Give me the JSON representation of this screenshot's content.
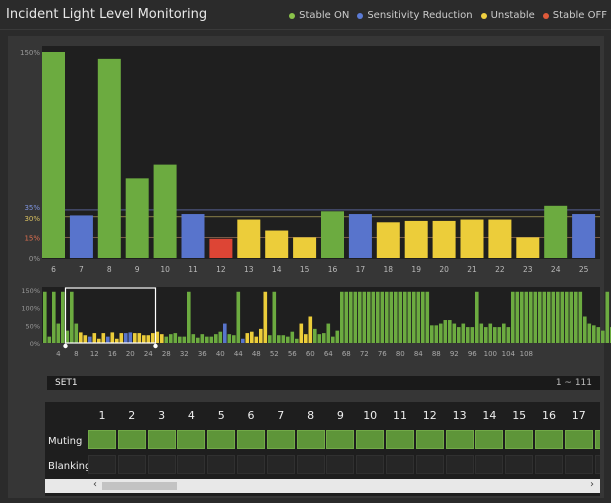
{
  "title": "Incident Light Level Monitoring",
  "legend": [
    {
      "label": "Stable ON",
      "color": "#8bc34a"
    },
    {
      "label": "Sensitivity Reduction",
      "color": "#5b7bd5"
    },
    {
      "label": "Unstable",
      "color": "#f0d040"
    },
    {
      "label": "Stable OFF",
      "color": "#e05a3a"
    }
  ],
  "colors": {
    "G": "#6cab40",
    "B": "#5874cc",
    "Y": "#eccd3a",
    "R": "#dd4535"
  },
  "chart_data": [
    {
      "type": "bar",
      "y_tick_labels": [
        "150%",
        "35%",
        "30%",
        "15%",
        "0%"
      ],
      "categories": [
        "6",
        "7",
        "8",
        "9",
        "10",
        "11",
        "12",
        "13",
        "14",
        "15",
        "16",
        "17",
        "18",
        "19",
        "20",
        "21",
        "22",
        "23",
        "24",
        "25"
      ],
      "values": [
        150,
        31,
        145,
        58,
        68,
        32,
        14,
        28,
        20,
        15,
        34,
        32,
        26,
        27,
        27,
        28,
        28,
        15,
        38,
        32
      ],
      "statuses": [
        "G",
        "B",
        "G",
        "G",
        "G",
        "B",
        "R",
        "Y",
        "Y",
        "Y",
        "G",
        "B",
        "Y",
        "Y",
        "Y",
        "Y",
        "Y",
        "Y",
        "G",
        "B"
      ],
      "ylim": [
        0,
        150
      ],
      "reference_lines": [
        35,
        30,
        15
      ]
    },
    {
      "type": "bar",
      "y_tick_labels": [
        "150%",
        "100%",
        "50%",
        "0%"
      ],
      "x_tick_labels": [
        "4",
        "8",
        "12",
        "16",
        "20",
        "24",
        "28",
        "32",
        "36",
        "40",
        "44",
        "48",
        "52",
        "56",
        "60",
        "64",
        "68",
        "72",
        "76",
        "80",
        "84",
        "88",
        "92",
        "96",
        "100",
        "104",
        "108"
      ],
      "values": [
        145,
        18,
        145,
        55,
        145,
        35,
        145,
        55,
        30,
        22,
        18,
        28,
        12,
        28,
        18,
        30,
        12,
        28,
        28,
        30,
        28,
        28,
        22,
        22,
        28,
        32,
        25,
        18,
        25,
        28,
        18,
        18,
        145,
        25,
        15,
        25,
        18,
        18,
        25,
        32,
        55,
        25,
        22,
        145,
        12,
        28,
        32,
        18,
        40,
        145,
        22,
        145,
        22,
        22,
        18,
        32,
        12,
        55,
        25,
        75,
        40,
        25,
        28,
        55,
        18,
        35,
        145,
        145,
        145,
        145,
        145,
        145,
        145,
        145,
        145,
        145,
        145,
        145,
        145,
        145,
        145,
        145,
        145,
        145,
        145,
        145,
        50,
        50,
        55,
        65,
        65,
        55,
        45,
        55,
        45,
        45,
        145,
        55,
        45,
        55,
        45,
        45,
        55,
        45,
        145,
        145,
        145,
        145,
        145,
        145,
        145,
        145,
        145,
        145,
        145,
        145,
        145,
        145,
        145,
        145,
        75,
        55,
        50,
        45,
        35,
        145,
        45,
        55,
        40,
        45,
        145,
        45,
        45
      ],
      "statuses": "GGGGGGGGYYBYYYBYYYBBYYYYYYYGGGGGGGGGGGGGBGGGBYYYYYGGGGGGGYYYGGGGGGGGGGGGGGGGGGGGGGGGGGGGGGGGGGGGGGGGGGGGGGGGGGGGGGGGGGGGGGGGGGGGGGGGGGGGGGGGGGGGGGGG",
      "selection": {
        "start": 6,
        "end": 25
      }
    }
  ],
  "set_label": "SET1",
  "set_range": "1 ~ 111",
  "grid": {
    "columns": [
      "1",
      "2",
      "3",
      "4",
      "5",
      "6",
      "7",
      "8",
      "9",
      "10",
      "11",
      "12",
      "13",
      "14",
      "15",
      "16",
      "17"
    ],
    "rows": [
      {
        "label": "Muting",
        "state": "on"
      },
      {
        "label": "Blanking",
        "state": "off"
      }
    ]
  },
  "scroll": {
    "left_arrow": "‹",
    "right_arrow": "›"
  }
}
